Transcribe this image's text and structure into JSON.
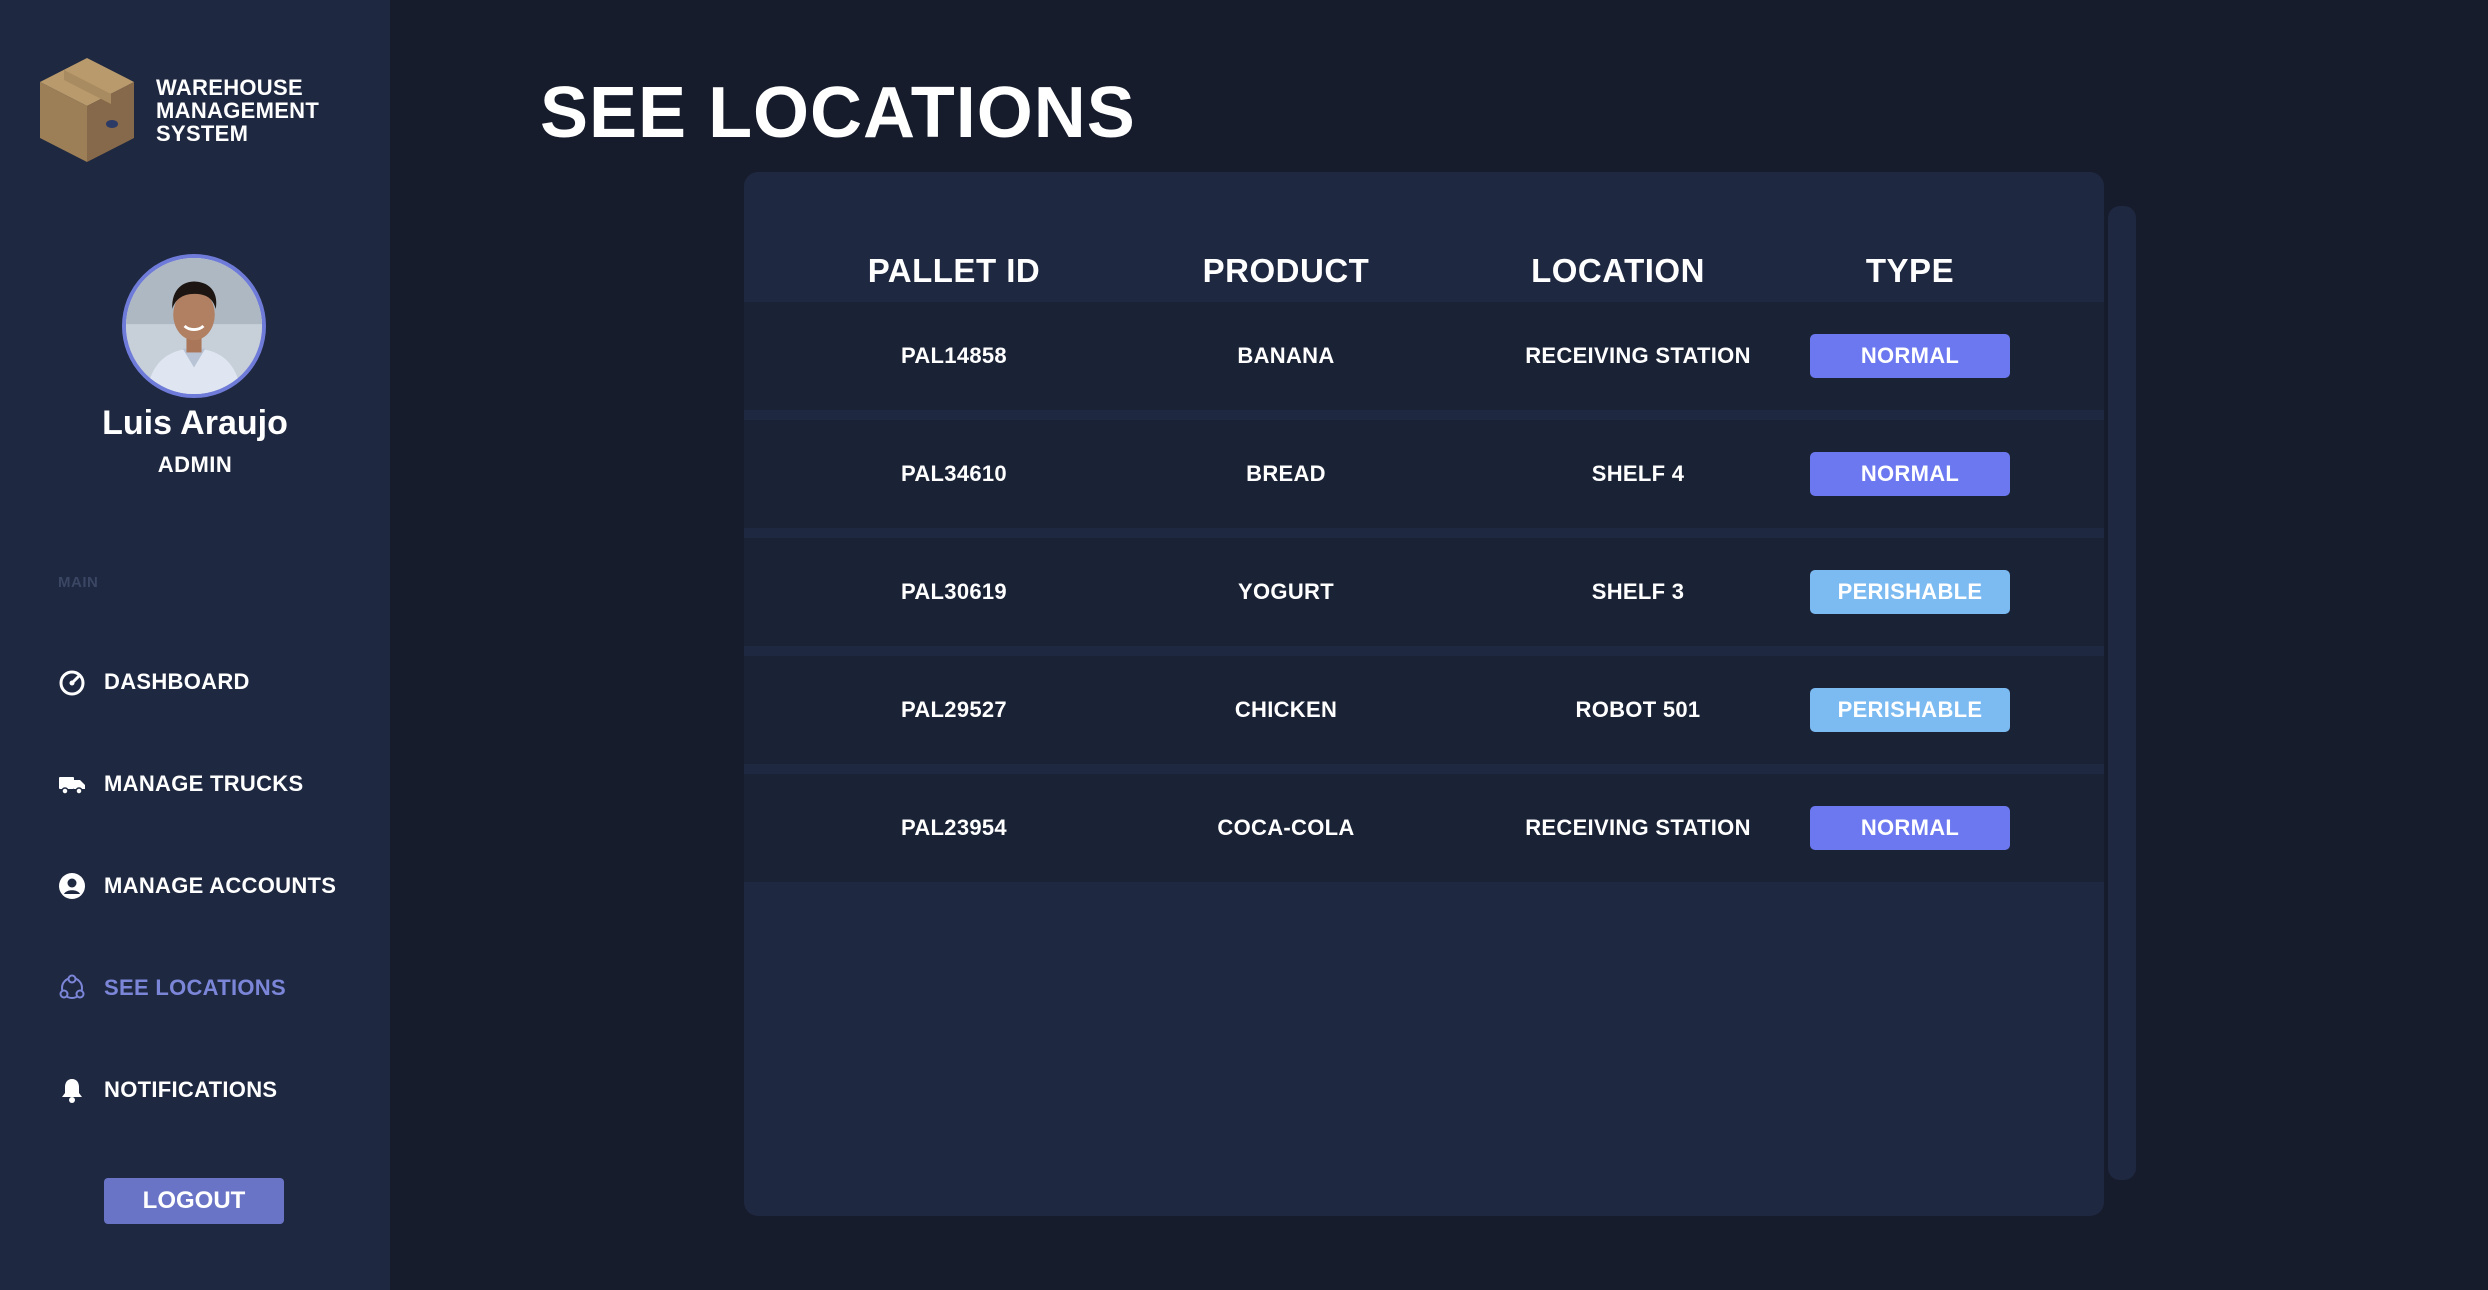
{
  "brand": {
    "line1": "WAREHOUSE",
    "line2": "MANAGEMENT",
    "line3": "SYSTEM"
  },
  "user": {
    "name": "Luis Araujo",
    "role": "ADMIN"
  },
  "sidebar": {
    "section_label": "MAIN",
    "items": [
      {
        "label": "DASHBOARD",
        "icon": "dashboard-gauge-icon",
        "active": false
      },
      {
        "label": "MANAGE TRUCKS",
        "icon": "truck-icon",
        "active": false
      },
      {
        "label": "MANAGE ACCOUNTS",
        "icon": "user-circle-icon",
        "active": false
      },
      {
        "label": "SEE LOCATIONS",
        "icon": "location-network-icon",
        "active": true
      },
      {
        "label": "NOTIFICATIONS",
        "icon": "bell-icon",
        "active": false
      }
    ],
    "logout_label": "LOGOUT"
  },
  "page": {
    "title": "SEE LOCATIONS"
  },
  "table": {
    "headers": [
      "PALLET ID",
      "PRODUCT",
      "LOCATION",
      "TYPE"
    ],
    "rows": [
      {
        "pallet_id": "PAL14858",
        "product": "BANANA",
        "location": "RECEIVING STATION",
        "type": "NORMAL"
      },
      {
        "pallet_id": "PAL34610",
        "product": "BREAD",
        "location": "SHELF 4",
        "type": "NORMAL"
      },
      {
        "pallet_id": "PAL30619",
        "product": "YOGURT",
        "location": "SHELF 3",
        "type": "PERISHABLE"
      },
      {
        "pallet_id": "PAL29527",
        "product": "CHICKEN",
        "location": "ROBOT 501",
        "type": "PERISHABLE"
      },
      {
        "pallet_id": "PAL23954",
        "product": "COCA-COLA",
        "location": "RECEIVING STATION",
        "type": "NORMAL"
      }
    ]
  },
  "colors": {
    "background": "#161c2c",
    "sidebar": "#1e2840",
    "panel": "#1f2841",
    "row": "#1a2236",
    "accent": "#7c86d9",
    "badge_normal": "#6b78f0",
    "badge_perishable": "#7cbaf2",
    "logout": "#6a74c7"
  }
}
